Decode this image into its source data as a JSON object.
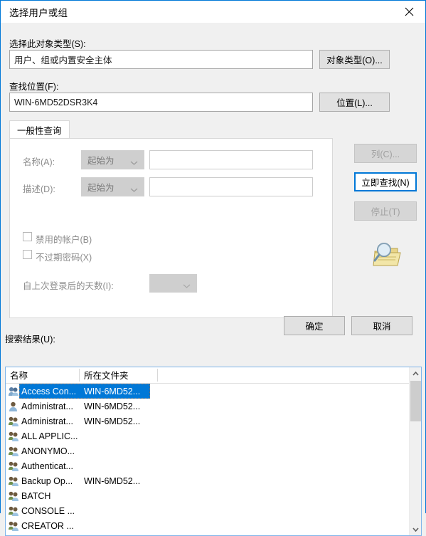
{
  "window": {
    "title": "选择用户或组",
    "close_label": "✕",
    "accent_color": "#0078d7"
  },
  "object_type": {
    "label": "选择此对象类型(S):",
    "value": "用户、组或内置安全主体",
    "button": "对象类型(O)..."
  },
  "location": {
    "label": "查找位置(F):",
    "value": "WIN-6MD52DSR3K4",
    "button": "位置(L)..."
  },
  "tabs": [
    {
      "label": "一般性查询",
      "selected": true
    }
  ],
  "query_form": {
    "name": {
      "label": "名称(A):",
      "condition": "起始为",
      "value": ""
    },
    "description": {
      "label": "描述(D):",
      "condition": "起始为",
      "value": ""
    },
    "disabled_accounts": {
      "label": "禁用的帐户(B)",
      "checked": false
    },
    "non_expiring_password": {
      "label": "不过期密码(X)",
      "checked": false
    },
    "days_since_last_logon": {
      "label": "自上次登录后的天数(I):",
      "value": ""
    }
  },
  "side_buttons": {
    "columns": {
      "label": "列(C)...",
      "enabled": false
    },
    "find_now": {
      "label": "立即查找(N)",
      "enabled": true,
      "focused": true
    },
    "stop": {
      "label": "停止(T)",
      "enabled": false
    },
    "decoration_icon": "search-folder-icon"
  },
  "dialog_buttons": {
    "ok": "确定",
    "cancel": "取消"
  },
  "results": {
    "label": "搜索结果(U):",
    "columns": [
      "名称",
      "所在文件夹"
    ],
    "rows": [
      {
        "name": "Access Con...",
        "folder": "WIN-6MD52...",
        "icon": "group-icon",
        "selected": true
      },
      {
        "name": "Administrat...",
        "folder": "WIN-6MD52...",
        "icon": "user-icon",
        "selected": false
      },
      {
        "name": "Administrat...",
        "folder": "WIN-6MD52...",
        "icon": "group-icon",
        "selected": false
      },
      {
        "name": "ALL APPLIC...",
        "folder": "",
        "icon": "group-icon",
        "selected": false
      },
      {
        "name": "ANONYMO...",
        "folder": "",
        "icon": "group-icon",
        "selected": false
      },
      {
        "name": "Authenticat...",
        "folder": "",
        "icon": "group-icon",
        "selected": false
      },
      {
        "name": "Backup Op...",
        "folder": "WIN-6MD52...",
        "icon": "group-icon",
        "selected": false
      },
      {
        "name": "BATCH",
        "folder": "",
        "icon": "group-icon",
        "selected": false
      },
      {
        "name": "CONSOLE ...",
        "folder": "",
        "icon": "group-icon",
        "selected": false
      },
      {
        "name": "CREATOR ...",
        "folder": "",
        "icon": "group-icon",
        "selected": false
      }
    ],
    "scrollbar": {
      "up": "▲",
      "down": "▼"
    }
  }
}
